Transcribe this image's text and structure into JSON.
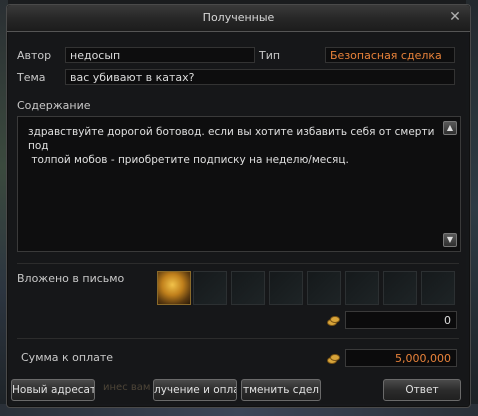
{
  "window": {
    "title": "Полученные",
    "close_glyph": "✕"
  },
  "author": {
    "label": "Автор",
    "value": "недосып"
  },
  "type": {
    "label": "Тип",
    "value": "Безопасная сделка",
    "color": "#e8823a"
  },
  "subject": {
    "label": "Тема",
    "value": "вас убивают в катах?"
  },
  "content": {
    "label": "Содержание",
    "text": "здравствуйте дорогой ботовод. если вы хотите избавить себя от смерти под\n толпой мобов - приобретите подписку на неделю/месяц.",
    "scroll_up_glyph": "▲",
    "scroll_down_glyph": "▼"
  },
  "attachments": {
    "label": "Вложено в письмо",
    "adena_value": "0"
  },
  "payment": {
    "label": "Сумма к оплате",
    "value": "5,000,000",
    "color": "#e8823a"
  },
  "buttons": {
    "new_addressee": "Новый адресат",
    "receive_and_pay": "лучение и опла",
    "cancel_deal": "тменить сдел",
    "reply": "Ответ"
  },
  "background_text": "инес вам"
}
